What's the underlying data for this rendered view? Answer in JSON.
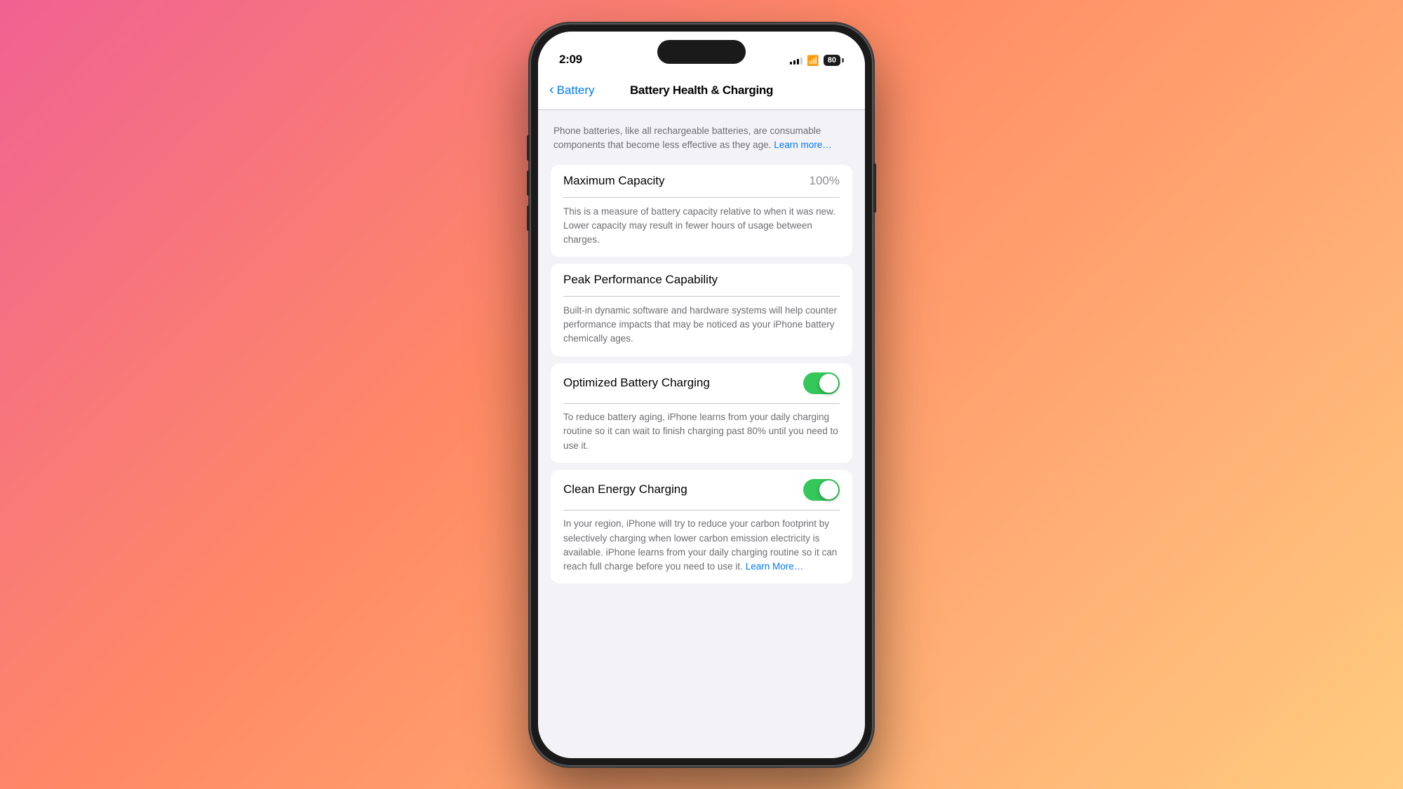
{
  "status_bar": {
    "time": "2:09",
    "battery_level": "80",
    "battery_charging": false
  },
  "nav": {
    "back_label": "Battery",
    "title": "Battery Health & Charging"
  },
  "intro": {
    "text": "Phone batteries, like all rechargeable batteries, are consumable components that become less effective as they age.",
    "learn_more": "Learn more…"
  },
  "maximum_capacity": {
    "label": "Maximum Capacity",
    "value": "100%",
    "description": "This is a measure of battery capacity relative to when it was new. Lower capacity may result in fewer hours of usage between charges."
  },
  "peak_performance": {
    "label": "Peak Performance Capability",
    "description": "Built-in dynamic software and hardware systems will help counter performance impacts that may be noticed as your iPhone battery chemically ages."
  },
  "optimized_charging": {
    "label": "Optimized Battery Charging",
    "enabled": true,
    "description": "To reduce battery aging, iPhone learns from your daily charging routine so it can wait to finish charging past 80% until you need to use it."
  },
  "clean_energy": {
    "label": "Clean Energy Charging",
    "enabled": true,
    "description": "In your region, iPhone will try to reduce your carbon footprint by selectively charging when lower carbon emission electricity is available. iPhone learns from your daily charging routine so it can reach full charge before you need to use it.",
    "learn_more": "Learn More…"
  }
}
